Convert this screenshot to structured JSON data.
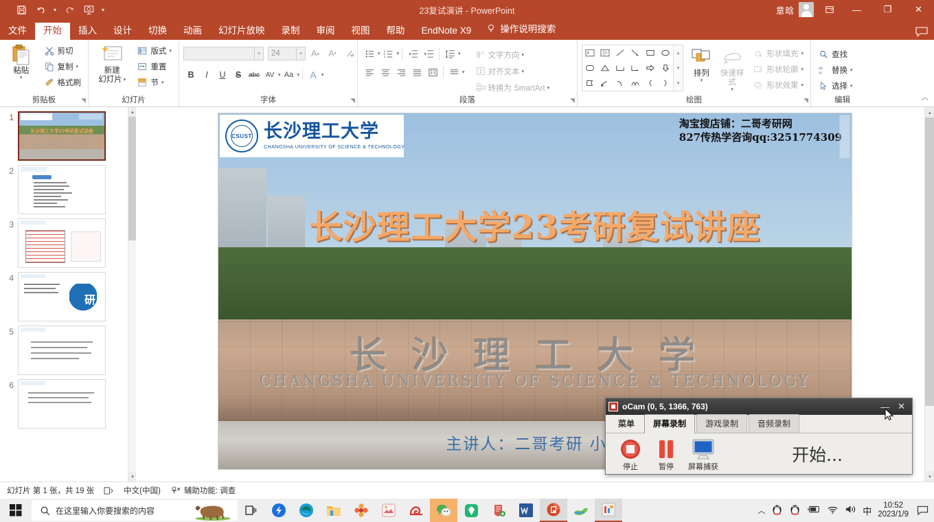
{
  "titlebar": {
    "document_title": "23复试演讲  -  PowerPoint",
    "user_name": "意晗",
    "qat": [
      {
        "name": "save",
        "icon": "save-icon"
      },
      {
        "name": "undo",
        "icon": "undo-icon"
      },
      {
        "name": "redo",
        "icon": "redo-icon"
      },
      {
        "name": "start-from-beginning",
        "icon": "slideshow-icon"
      },
      {
        "name": "customize-qat",
        "icon": "chevron-down-icon"
      }
    ],
    "window_buttons": {
      "ribbon_display": "ribbon-options-icon",
      "minimize": "—",
      "restore": "❐",
      "close": "✕"
    }
  },
  "ribbon_tabs": [
    {
      "label": "文件",
      "active": false
    },
    {
      "label": "开始",
      "active": true
    },
    {
      "label": "插入",
      "active": false
    },
    {
      "label": "设计",
      "active": false
    },
    {
      "label": "切换",
      "active": false
    },
    {
      "label": "动画",
      "active": false
    },
    {
      "label": "幻灯片放映",
      "active": false
    },
    {
      "label": "录制",
      "active": false
    },
    {
      "label": "审阅",
      "active": false
    },
    {
      "label": "视图",
      "active": false
    },
    {
      "label": "帮助",
      "active": false
    },
    {
      "label": "EndNote X9",
      "active": false
    }
  ],
  "tell_me": "操作说明搜索",
  "ribbon": {
    "clipboard": {
      "group_label": "剪贴板",
      "paste_label": "粘贴",
      "items": [
        {
          "label": "剪切",
          "icon": "scissors-icon"
        },
        {
          "label": "复制",
          "icon": "copy-icon"
        },
        {
          "label": "格式刷",
          "icon": "format-painter-icon"
        }
      ]
    },
    "slides": {
      "group_label": "幻灯片",
      "new_slide_label": "新建\n幻灯片",
      "items": [
        {
          "label": "版式",
          "icon": "layout-icon"
        },
        {
          "label": "重置",
          "icon": "reset-icon"
        },
        {
          "label": "节",
          "icon": "section-icon"
        }
      ]
    },
    "font": {
      "group_label": "字体",
      "font_name": "",
      "font_size": "24",
      "buttons": [
        "B",
        "I",
        "U",
        "S",
        "abc",
        "AV",
        "Aa",
        "A"
      ]
    },
    "paragraph": {
      "group_label": "段落",
      "items": [
        {
          "label": "文字方向",
          "icon": "text-direction-icon"
        },
        {
          "label": "对齐文本",
          "icon": "align-text-icon"
        },
        {
          "label": "转换为 SmartArt",
          "icon": "smartart-icon"
        }
      ]
    },
    "drawing": {
      "group_label": "绘图",
      "arrange_label": "排列",
      "quick_styles_label": "快速样式",
      "items": [
        {
          "label": "形状填充",
          "icon": "shape-fill-icon"
        },
        {
          "label": "形状轮廓",
          "icon": "shape-outline-icon"
        },
        {
          "label": "形状效果",
          "icon": "shape-effects-icon"
        }
      ]
    },
    "editing": {
      "group_label": "编辑",
      "items": [
        {
          "label": "查找",
          "icon": "search-icon"
        },
        {
          "label": "替换",
          "icon": "replace-icon"
        },
        {
          "label": "选择",
          "icon": "select-icon"
        }
      ]
    }
  },
  "thumbnails": [
    {
      "number": "1",
      "selected": true
    },
    {
      "number": "2",
      "selected": false
    },
    {
      "number": "3",
      "selected": false
    },
    {
      "number": "4",
      "selected": false
    },
    {
      "number": "5",
      "selected": false
    },
    {
      "number": "6",
      "selected": false
    }
  ],
  "slide": {
    "logo_cn": "长沙理工大学",
    "logo_en": "CHANGSHA UNIVERSITY OF SCIENCE & TECHNOLOGY",
    "shop_note_line1": "淘宝搜店铺：二哥考研网",
    "shop_note_line2": "827传热学咨询qq:3251774309",
    "title": "长沙理工大学23考研复试讲座",
    "subtitle": "主讲人：二哥考研  小哥",
    "wall_text": "长沙理工大学",
    "wall_english": "CHANGSHA UNIVERSITY OF SCIENCE & TECHNOLOGY"
  },
  "statusbar": {
    "slide_count": "幻灯片 第 1 张，共 19 张",
    "notes_icon": "notes-icon",
    "language": "中文(中国)",
    "accessibility_icon": "accessibility-icon",
    "accessibility": "辅助功能: 调查"
  },
  "ocam": {
    "title": "oCam (0, 5, 1366, 763)",
    "tabs": [
      {
        "label": "菜单",
        "active": false,
        "plain": true
      },
      {
        "label": "屏幕录制",
        "active": true,
        "plain": false
      },
      {
        "label": "游戏录制",
        "active": false,
        "plain": false
      },
      {
        "label": "音频录制",
        "active": false,
        "plain": false
      }
    ],
    "buttons": [
      {
        "label": "停止",
        "icon": "stop-record-icon"
      },
      {
        "label": "暂停",
        "icon": "pause-icon"
      },
      {
        "label": "屏幕捕获",
        "icon": "screen-capture-icon"
      }
    ],
    "status_text": "开始...",
    "minimize": "—",
    "close": "✕"
  },
  "taskbar": {
    "start_icon": "windows-start-icon",
    "search_placeholder": "在这里输入你要搜索的内容",
    "search_icon": "search-icon",
    "icons": [
      {
        "name": "task-view-icon"
      },
      {
        "name": "thunder-download-icon"
      },
      {
        "name": "edge-browser-icon"
      },
      {
        "name": "file-explorer-icon"
      },
      {
        "name": "flower-app-icon"
      },
      {
        "name": "photo-app-icon"
      },
      {
        "name": "snail-browser-icon"
      },
      {
        "name": "wechat-icon",
        "highlighted": true
      },
      {
        "name": "youdao-icon"
      },
      {
        "name": "note-app-icon"
      },
      {
        "name": "word-icon"
      },
      {
        "name": "powerpoint-icon",
        "active": true
      },
      {
        "name": "seafile-icon"
      },
      {
        "name": "ocam-icon",
        "active": true
      }
    ],
    "tray": {
      "expand_icon": "chevron-up-icon",
      "qq1_icon": "qq-penguin-icon",
      "qq2_icon": "qq-penguin-icon",
      "battery_icon": "battery-icon",
      "wifi_icon": "wifi-icon",
      "volume_icon": "volume-icon",
      "ime_label": "中",
      "time": "10:52",
      "date": "2023/1/9",
      "notification_icon": "notification-icon"
    }
  }
}
